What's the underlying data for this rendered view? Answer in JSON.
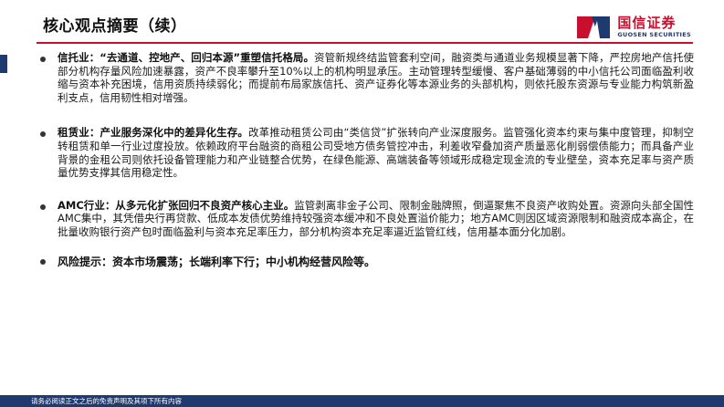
{
  "header": {
    "title": "核心观点摘要（续）",
    "logo": {
      "name_cn": "国信证券",
      "name_en": "GUOSEN SECURITIES",
      "colors": {
        "red": "#c8102e",
        "blue": "#1f3a6e"
      }
    }
  },
  "bullets": [
    {
      "heading": "信托业：“去通道、控地产、回归本源”重塑信托格局。",
      "body": "资管新规终结监管套利空间，融资类与通道业务规模显著下降，严控房地产信托使部分机构存量风险加速暴露，资产不良率攀升至10%以上的机构明显承压。主动管理转型缓慢、客户基础薄弱的中小信托公司面临盈利收缩与资本补充困境，信用资质持续弱化；而提前布局家族信托、资产证券化等本源业务的头部机构，则依托股东资源与专业能力构筑新盈利支点，信用韧性相对增强。"
    },
    {
      "heading": "租赁业：产业服务深化中的差异化生存。",
      "body": "改革推动租赁公司由“类信贷”扩张转向产业深度服务。监管强化资本约束与集中度管理，抑制空转租赁和单一行业过度投放。依赖政府平台融资的商租公司受地方债务管控冲击，利差收窄叠加资产质量恶化削弱偿债能力；而具备产业背景的金租公司则依托设备管理能力和产业链整合优势，在绿色能源、高端装备等领域形成稳定现金流的专业壁垒，资本充足率与资产质量优势支撑其信用稳定性。"
    },
    {
      "heading": "AMC行业：从多元化扩张回归不良资产核心主业。",
      "body": "监管剥离非金子公司、限制金融牌照，倒逼聚焦不良资产收购处置。资源向头部全国性AMC集中，其凭借央行再贷款、低成本发债优势维持较强资本缓冲和不良处置溢价能力；地方AMC则因区域资源限制和融资成本高企，在批量收购银行资产包时面临盈利与资本充足率压力，部分机构资本充足率逼近监管红线，信用基本面分化加剧。"
    }
  ],
  "risk": {
    "text": "风险提示：资本市场震荡；长端利率下行；中小机构经营风险等。"
  },
  "footer": {
    "disclaimer": "请务必阅读正文之后的免责声明及其项下所有内容"
  }
}
